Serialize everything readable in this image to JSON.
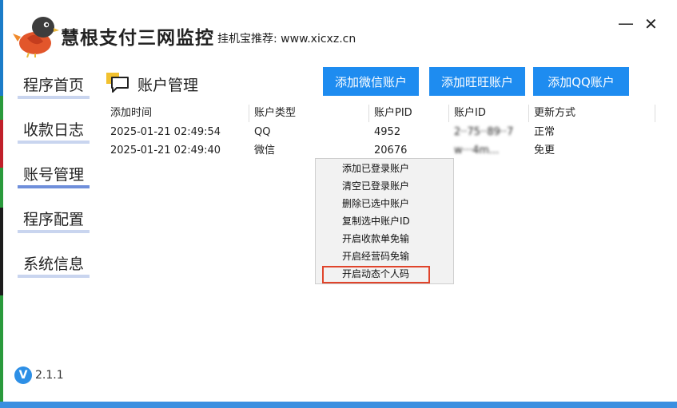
{
  "header": {
    "title": "慧根支付三网监控",
    "subtitle": "挂机宝推荐: www.xicxz.cn",
    "minimize_icon": "minimize-icon",
    "close_icon": "close-icon"
  },
  "sidebar": {
    "items": [
      {
        "label": "程序首页"
      },
      {
        "label": "收款日志"
      },
      {
        "label": "账号管理",
        "active": true
      },
      {
        "label": "程序配置"
      },
      {
        "label": "系统信息"
      }
    ]
  },
  "main": {
    "section_title": "账户管理",
    "buttons": {
      "add_wechat": "添加微信账户",
      "add_wangwang": "添加旺旺账户",
      "add_qq": "添加QQ账户"
    },
    "table": {
      "headers": [
        "添加时间",
        "账户类型",
        "账户PID",
        "账户ID",
        "更新方式"
      ],
      "rows": [
        {
          "time": "2025-01-21 02:49:54",
          "type": "QQ",
          "pid": "4952",
          "id": "2··75··89··7",
          "mode": "正常"
        },
        {
          "time": "2025-01-21 02:49:40",
          "type": "微信",
          "pid": "20676",
          "id": "w···4m...",
          "mode": "免更"
        }
      ]
    }
  },
  "context_menu": {
    "items": [
      "添加已登录账户",
      "清空已登录账户",
      "删除已选中账户",
      "复制选中账户ID",
      "开启收款单免输",
      "开启经营码免输",
      "开启动态个人码"
    ],
    "highlighted_index": 6
  },
  "footer": {
    "version_badge": "V",
    "version": "2.1.1"
  },
  "colors": {
    "accent_button": "#1e8cf0",
    "nav_active_bar": "#6f8fdb",
    "nav_bar": "#c9d5ef",
    "highlight_border": "#e0442b"
  }
}
